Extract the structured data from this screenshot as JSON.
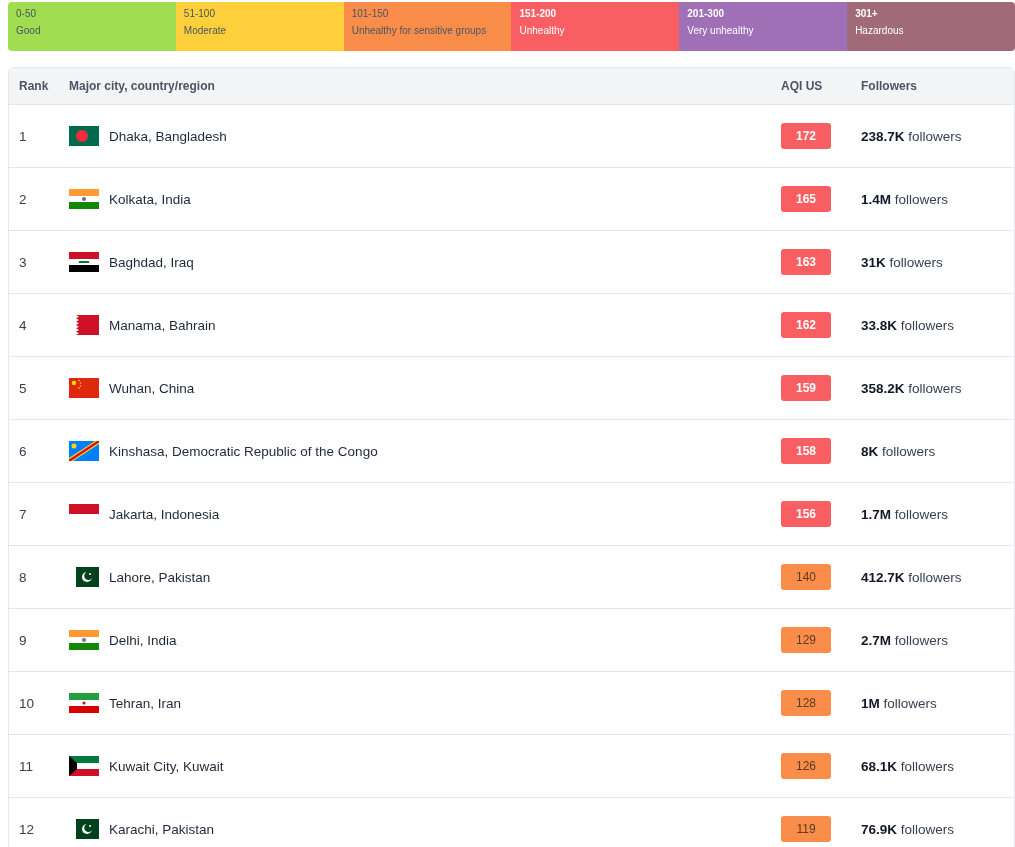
{
  "legend": [
    {
      "range": "0-50",
      "label": "Good",
      "color": "#a0dd50"
    },
    {
      "range": "51-100",
      "label": "Moderate",
      "color": "#fdd03b"
    },
    {
      "range": "101-150",
      "label": "Unhealthy for sensitive groups",
      "color": "#fb8d4a"
    },
    {
      "range": "151-200",
      "label": "Unhealthy",
      "color": "#f95f62"
    },
    {
      "range": "201-300",
      "label": "Very unhealthy",
      "color": "#a070b6"
    },
    {
      "range": "301+",
      "label": "Hazardous",
      "color": "#a06a7b"
    }
  ],
  "table": {
    "columns": [
      "Rank",
      "Major city, country/region",
      "AQI US",
      "Followers"
    ],
    "rows": [
      {
        "rank": "1",
        "kind": "bangladesh",
        "city": "Dhaka, Bangladesh",
        "aqi": "172",
        "color": "#f95f62",
        "followers": "**238.7K** followers"
      },
      {
        "rank": "2",
        "kind": "india",
        "city": "Kolkata, India",
        "aqi": "165",
        "color": "#f95f62",
        "followers": "**1.4M** followers"
      },
      {
        "rank": "3",
        "kind": "iraq",
        "city": "Baghdad, Iraq",
        "aqi": "163",
        "color": "#f95f62",
        "followers": "**31K** followers"
      },
      {
        "rank": "4",
        "kind": "bahrain",
        "city": "Manama, Bahrain",
        "aqi": "162",
        "color": "#f95f62",
        "followers": "**33.8K** followers"
      },
      {
        "rank": "5",
        "kind": "china",
        "city": "Wuhan, China",
        "aqi": "159",
        "color": "#f95f62",
        "followers": "**358.2K** followers"
      },
      {
        "rank": "6",
        "kind": "congo",
        "city": "Kinshasa, Democratic Republic of the Congo",
        "aqi": "158",
        "color": "#f95f62",
        "followers": "**8K** followers"
      },
      {
        "rank": "7",
        "kind": "indonesia",
        "city": "Jakarta, Indonesia",
        "aqi": "156",
        "color": "#f95f62",
        "followers": "**1.7M** followers"
      },
      {
        "rank": "8",
        "kind": "pakistan",
        "city": "Lahore, Pakistan",
        "aqi": "140",
        "color": "#fb8d4a",
        "followers": "**412.7K** followers"
      },
      {
        "rank": "9",
        "kind": "india",
        "city": "Delhi, India",
        "aqi": "129",
        "color": "#fb8d4a",
        "followers": "**2.7M** followers"
      },
      {
        "rank": "10",
        "kind": "iran",
        "city": "Tehran, Iran",
        "aqi": "128",
        "color": "#fb8d4a",
        "followers": "**1M** followers"
      },
      {
        "rank": "11",
        "kind": "kuwait",
        "city": "Kuwait City, Kuwait",
        "aqi": "126",
        "color": "#fb8d4a",
        "followers": "**68.1K** followers"
      },
      {
        "rank": "12",
        "kind": "pakistan",
        "city": "Karachi, Pakistan",
        "aqi": "119",
        "color": "#fb8d4a",
        "followers": "**76.9K** followers"
      }
    ]
  }
}
